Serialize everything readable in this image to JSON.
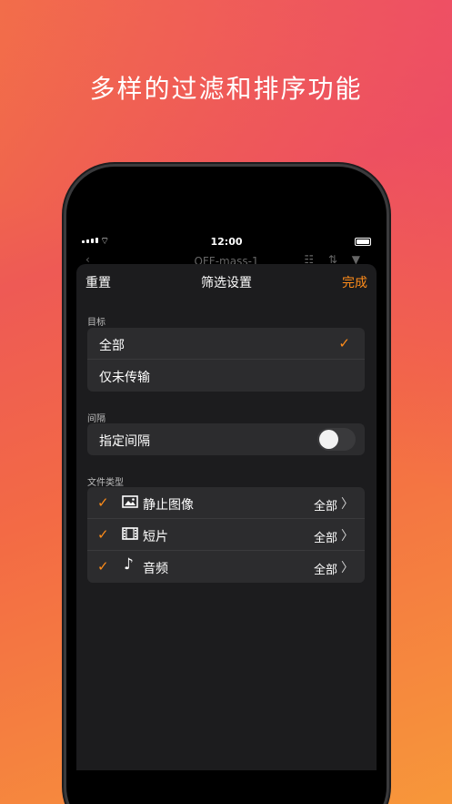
{
  "headline": "多样的过滤和排序功能",
  "status_bar": {
    "time": "12:00"
  },
  "under_nav": {
    "back": "‹",
    "title": "OFF-mass-1",
    "icons": "☷ ⇅ ▼"
  },
  "sheet": {
    "reset_label": "重置",
    "title": "筛选设置",
    "done_label": "完成",
    "target": {
      "section_label": "目标",
      "options": [
        {
          "label": "全部",
          "selected": true
        },
        {
          "label": "仅未传输",
          "selected": false
        }
      ]
    },
    "interval": {
      "section_label": "间隔",
      "toggle_label": "指定间隔",
      "enabled": false
    },
    "file_types": {
      "section_label": "文件类型",
      "items": [
        {
          "label": "静止图像",
          "icon": "image-icon",
          "value": "全部",
          "checked": true
        },
        {
          "label": "短片",
          "icon": "film-icon",
          "value": "全部",
          "checked": true
        },
        {
          "label": "音频",
          "icon": "music-note-icon",
          "value": "全部",
          "checked": true
        }
      ]
    }
  },
  "colors": {
    "accent": "#ff8c1a",
    "sheet_bg": "#1c1c1e",
    "cell_bg": "#2c2c2e"
  }
}
